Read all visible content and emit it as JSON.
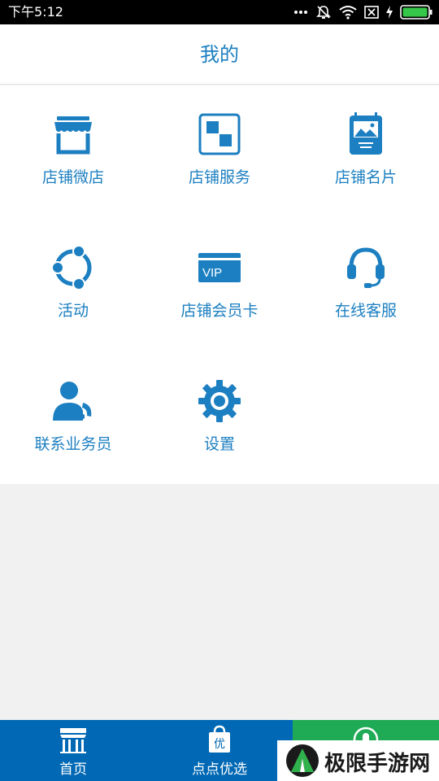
{
  "status_bar": {
    "time": "下午5:12"
  },
  "header": {
    "title": "我的"
  },
  "menu": [
    {
      "label": "店铺微店",
      "icon": "storefront-icon"
    },
    {
      "label": "店铺服务",
      "icon": "service-squares-icon"
    },
    {
      "label": "店铺名片",
      "icon": "business-card-icon"
    },
    {
      "label": "活动",
      "icon": "activity-share-icon"
    },
    {
      "label": "店铺会员卡",
      "icon": "vip-card-icon"
    },
    {
      "label": "在线客服",
      "icon": "headset-icon"
    },
    {
      "label": "联系业务员",
      "icon": "salesperson-phone-icon"
    },
    {
      "label": "设置",
      "icon": "gear-icon"
    }
  ],
  "bottom_nav": [
    {
      "label": "首页",
      "icon": "home-store-icon"
    },
    {
      "label": "点点优选",
      "icon": "shopping-bag-icon",
      "badge": "优"
    },
    {
      "label": "",
      "icon": "user-icon"
    }
  ],
  "colors": {
    "accent": "#1c7fc1",
    "nav_blue": "#0068b4",
    "nav_green": "#1faa55",
    "status_bar": "#000000"
  },
  "watermark": {
    "text": "极限手游网"
  }
}
